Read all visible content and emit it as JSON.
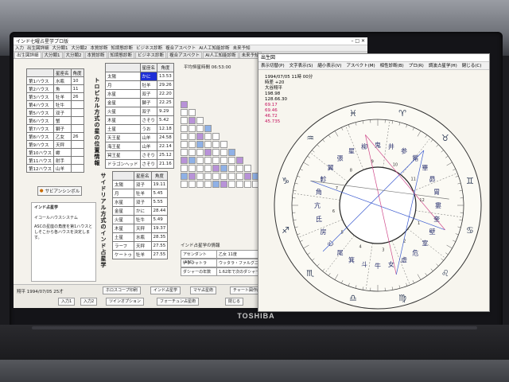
{
  "laptop": {
    "brand": "TOSHIBA"
  },
  "app": {
    "title": "インド七曜占星学プロ版",
    "menu": [
      "入力",
      "出生図詳細",
      "大分類1",
      "大分類2",
      "本質診断",
      "知境態診断",
      "ビジネス診断",
      "複合アスペクト",
      "AI人工知能診断",
      "未来予知"
    ],
    "tabs": [
      "出生図詳細",
      "大分類1",
      "大分類2",
      "本質診断",
      "知境態診断",
      "ビジネス診断",
      "複合アスペクト",
      "AI人工知能診断",
      "未来予知"
    ],
    "active_tab": "出生図詳細"
  },
  "houses": {
    "headers": [
      "",
      "星座名",
      "角度"
    ],
    "rows": [
      [
        "第1ハウス",
        "水瓶",
        "10"
      ],
      [
        "第2ハウス",
        "魚",
        "11"
      ],
      [
        "第3ハウス",
        "牡羊",
        "26"
      ],
      [
        "第4ハウス",
        "牡牛",
        ""
      ],
      [
        "第5ハウス",
        "双子",
        ""
      ],
      [
        "第6ハウス",
        "蟹",
        ""
      ],
      [
        "第7ハウス",
        "獅子",
        ""
      ],
      [
        "第8ハウス",
        "乙女",
        "26"
      ],
      [
        "第9ハウス",
        "天秤",
        ""
      ],
      [
        "第10ハウス",
        "蠍",
        ""
      ],
      [
        "第11ハウス",
        "射手",
        ""
      ],
      [
        "第12ハウス",
        "山羊",
        ""
      ]
    ]
  },
  "symbol_button": "サビアンシンボル",
  "indian_box": {
    "title": "インド占星学",
    "system": "イコールハウスシステム",
    "desc": "ASCの星座の角度を第1ハウスとしそこから各ハウスを決定します。"
  },
  "vertical_labels": {
    "tropical": "トロピカル方式の星の位置情報",
    "sidereal": "サイドリアル方式のインド占星学"
  },
  "planets": {
    "headers": [
      "",
      "星座名",
      "角度"
    ],
    "rows": [
      [
        "太陽",
        "かに",
        "13.53"
      ],
      [
        "月",
        "牡羊",
        "29.26"
      ],
      [
        "水星",
        "双子",
        "22.20"
      ],
      [
        "金星",
        "獅子",
        "22.25"
      ],
      [
        "火星",
        "双子",
        "9.29"
      ],
      [
        "木星",
        "さそり",
        "5.42"
      ],
      [
        "土星",
        "うお",
        "12.18"
      ],
      [
        "天王星",
        "山羊",
        "24.58"
      ],
      [
        "海王星",
        "山羊",
        "22.14"
      ],
      [
        "冥王星",
        "さそり",
        "25.12"
      ],
      [
        "ドラゴンヘッド",
        "さそり",
        "21.16"
      ]
    ]
  },
  "sidereal": {
    "headers": [
      "",
      "星座名",
      "角度"
    ],
    "rows": [
      [
        "太陽",
        "双子",
        "19.11"
      ],
      [
        "月",
        "牡羊",
        "5.45"
      ],
      [
        "水星",
        "双子",
        "5.55"
      ],
      [
        "金星",
        "かに",
        "28.44"
      ],
      [
        "火星",
        "牡牛",
        "5.49"
      ],
      [
        "木星",
        "天秤",
        "19.37"
      ],
      [
        "土星",
        "水瓶",
        "28.35"
      ],
      [
        "ラーフ",
        "天秤",
        "27.55"
      ],
      [
        "ケートゥ",
        "牡羊",
        "27.55"
      ]
    ]
  },
  "sunrise": {
    "label": "平均恒星時間",
    "value": "06:53:00"
  },
  "vedic_info": {
    "title": "インド占星学の情報",
    "rows": [
      [
        "アセンダント(ASC)",
        "乙女 11度"
      ],
      [
        "ナクシャトラ",
        "ウッタラ・ファルグニー"
      ],
      [
        "ダシャーの年数",
        "1.62年で次のダシャー"
      ]
    ]
  },
  "bottom": {
    "status": "翔平 1994/07/05 25才",
    "buttons": [
      "ホロスコープ印刷",
      "インド占星学",
      "マヤ占星術",
      "チャート図作成",
      "入力1",
      "入力2",
      "ツインオプション",
      "フォーチュン占星術",
      "閉じる"
    ]
  },
  "chart_window": {
    "title": "出生図",
    "menu": [
      "表示切替(P)",
      "文字表示(S)",
      "縮小表示(V)",
      "アスペクト(M)",
      "相性診断(B)",
      "プロ(R)",
      "調波占星学(H)",
      "閉じる(C)"
    ],
    "info_lines": [
      "1994/07/05 11時 00分",
      "時差 +20",
      "大谷翔平"
    ],
    "numbers": [
      "198.98",
      "128.66.30",
      "69.17",
      "69.46",
      "46.72",
      "45.735"
    ],
    "mansions": [
      "鬼",
      "井",
      "参",
      "觜",
      "畢",
      "昴",
      "胃",
      "婁",
      "奎",
      "壁",
      "室",
      "危",
      "虚",
      "女",
      "牛",
      "斗",
      "箕",
      "尾",
      "心",
      "房",
      "氐",
      "亢",
      "角",
      "軫",
      "翼",
      "張",
      "星",
      "柳"
    ],
    "house_numbers": [
      "1",
      "2",
      "3",
      "4",
      "5",
      "6",
      "7",
      "8",
      "9",
      "10",
      "11",
      "12"
    ]
  }
}
